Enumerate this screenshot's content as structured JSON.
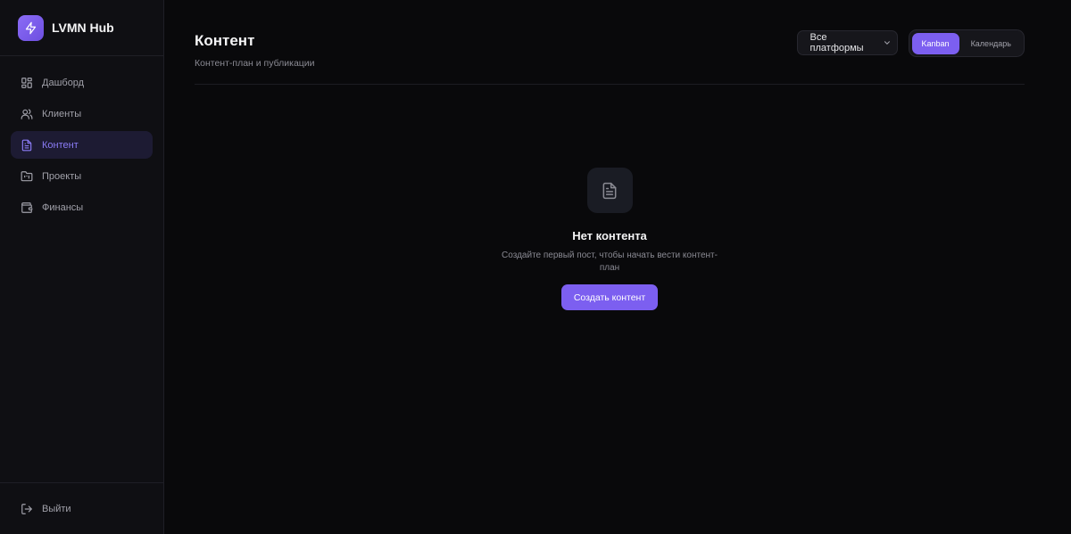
{
  "brand": {
    "name": "LVMN Hub",
    "icon": "bolt-icon",
    "color": "#7c5ff0"
  },
  "sidebar": {
    "items": [
      {
        "label": "Дашборд",
        "icon": "dashboard-grid-icon",
        "active": false
      },
      {
        "label": "Клиенты",
        "icon": "users-icon",
        "active": false
      },
      {
        "label": "Контент",
        "icon": "file-text-icon",
        "active": true
      },
      {
        "label": "Проекты",
        "icon": "folder-kanban-icon",
        "active": false
      },
      {
        "label": "Финансы",
        "icon": "wallet-icon",
        "active": false
      }
    ],
    "logout_label": "Выйти"
  },
  "header": {
    "title": "Контент",
    "subtitle": "Контент-план и публикации",
    "platform_select": {
      "value": "Все платформы"
    },
    "view_toggle": {
      "options": [
        "Kanban",
        "Календарь"
      ],
      "selected": "Kanban"
    }
  },
  "empty_state": {
    "icon": "file-text-icon",
    "title": "Нет контента",
    "description": "Создайте первый пост, чтобы начать вести контент-план",
    "button_label": "Создать контент"
  },
  "colors": {
    "background": "#09090b",
    "sidebar": "#0f0f13",
    "accent": "#7c5ff0",
    "active_nav_bg": "#1d1b33",
    "active_nav_text": "#8b7cf6"
  }
}
